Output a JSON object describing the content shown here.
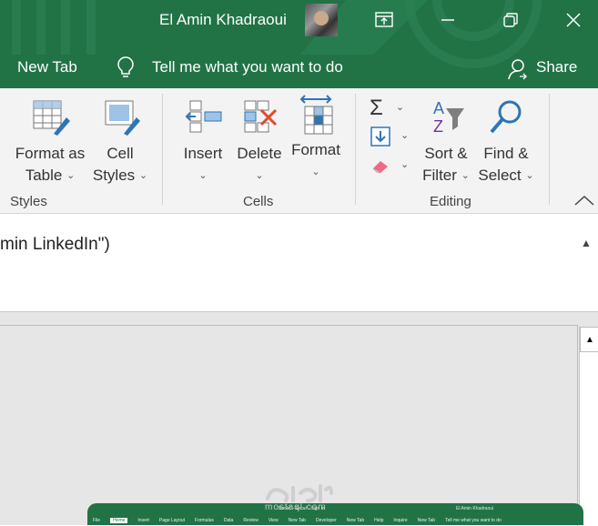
{
  "titlebar": {
    "user_name": "El Amin Khadraoui",
    "tab_new": "New Tab",
    "tell_me": "Tell me what you want to do",
    "share": "Share"
  },
  "ribbon": {
    "format_as_table": [
      "Format as",
      "Table"
    ],
    "cell_styles": [
      "Cell",
      "Styles"
    ],
    "insert": "Insert",
    "delete": "Delete",
    "format": "Format",
    "sort_filter": [
      "Sort &",
      "Filter"
    ],
    "find_select": [
      "Find &",
      "Select"
    ],
    "groups": {
      "styles": "Styles",
      "cells": "Cells",
      "editing": "Editing"
    }
  },
  "formula_bar": {
    "text": "min LinkedIn\")"
  },
  "thumbnail": {
    "title": "Book1 - Excel  ·  Sign in",
    "user": "El Amin Khadraoui",
    "tabs": [
      "File",
      "Home",
      "Insert",
      "Page Layout",
      "Formulas",
      "Data",
      "Review",
      "View",
      "New Tab",
      "Developer",
      "New Tab",
      "Help",
      "Inquire",
      "New Tab",
      "Tell me what you want to do"
    ]
  },
  "watermark": {
    "text": "mostaql.com"
  },
  "colors": {
    "excel_green": "#217346",
    "ribbon_bg": "#f3f3f3",
    "grid_bg": "#e6e6e6"
  }
}
